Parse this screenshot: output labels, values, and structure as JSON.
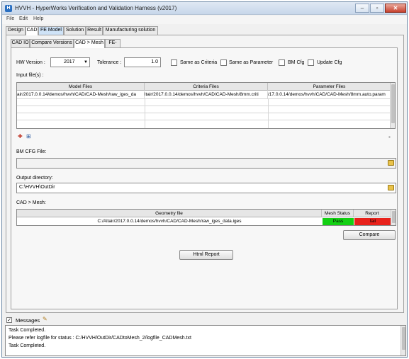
{
  "window": {
    "title": "HVVH - HyperWorks Verification and Validation Harness (v2017)",
    "app_icon_text": "H"
  },
  "menubar": [
    "File",
    "Edit",
    "Help"
  ],
  "main_tabs": [
    "Design",
    "CAD",
    "FE Model",
    "Solution",
    "Result",
    "Manufacturing solution"
  ],
  "sub_tabs": [
    "CAD IO",
    "Compare Versions",
    "CAD > Mesh",
    "FE-FE"
  ],
  "form": {
    "hw_version_label": "HW Version :",
    "hw_version_value": "2017",
    "tolerance_label": "Tolerance :",
    "tolerance_value": "1.0",
    "checkboxes": [
      "Same as Criteria",
      "Same as Parameter",
      "BM Cfg",
      "Update Cfg"
    ]
  },
  "input_files": {
    "label": "Input file(s) :",
    "columns": [
      "Model Files",
      "Criteria Files",
      "Parameter Files"
    ],
    "rows": [
      [
        "air/2017.0.0.14/demos/hvvh/CAD/CAD-Mesh/raw_iges_da",
        "ltair/2017.0.0.14/demos/hvvh/CAD/CAD-Mesh/8mm.criti",
        "/17.0.0.14/demos/hvvh/CAD/CAD-Mesh/8mm.auto.param"
      ]
    ]
  },
  "bm_cfg": {
    "label": "BM CFG File:",
    "value": ""
  },
  "output_dir": {
    "label": "Output directory:",
    "value": "C:\\HVVH\\OutDir"
  },
  "cad_mesh": {
    "label": "CAD > Mesh:",
    "columns": [
      "Geometry file",
      "Mesh Status",
      "Report"
    ],
    "rows": [
      {
        "file": "C:/Altair/2017.0.0.14/demos/hvvh/CAD/CAD-Mesh/raw_iges_data.iges",
        "status": "Pass",
        "report": "fail"
      }
    ],
    "status_colors": {
      "pass": "#13d013",
      "fail": "#e8221b"
    }
  },
  "buttons": {
    "compare": "Compare",
    "html_report": "Html Report"
  },
  "messages": {
    "label": "Messages",
    "lines": [
      "Task Completed.",
      "Please refer logfile for status : C:/HVVH/OutDir/CADtoMesh_2/logfile_CADMesh.txt",
      "Task Completed."
    ]
  }
}
